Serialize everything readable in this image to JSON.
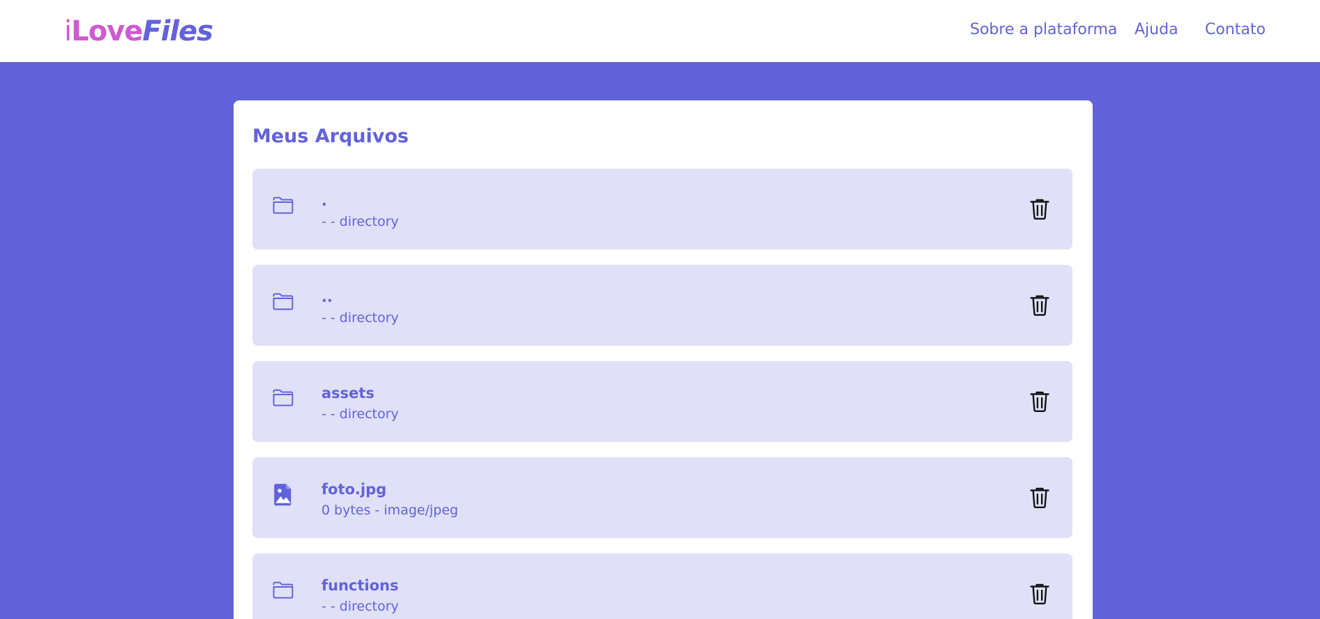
{
  "logo": {
    "part1": "i",
    "part2": "Love",
    "part3": "Files"
  },
  "nav": {
    "links": [
      "Sobre a plataforma",
      "Ajuda",
      "Contato"
    ]
  },
  "main": {
    "title": "Meus Arquivos",
    "files": [
      {
        "name": ".",
        "meta": "- - directory",
        "icon": "folder-icon"
      },
      {
        "name": "..",
        "meta": "- - directory",
        "icon": "folder-icon"
      },
      {
        "name": "assets",
        "meta": "- - directory",
        "icon": "folder-icon"
      },
      {
        "name": "foto.jpg",
        "meta": "0 bytes - image/jpeg",
        "icon": "image-file-icon"
      },
      {
        "name": "functions",
        "meta": "- - directory",
        "icon": "folder-icon"
      }
    ],
    "delete_icon": "trash-icon"
  },
  "colors": {
    "accent": "#6262db",
    "logo_pink": "#ce5ad2",
    "row_bg": "#e0e0f8",
    "panel_bg": "#ffffff"
  }
}
